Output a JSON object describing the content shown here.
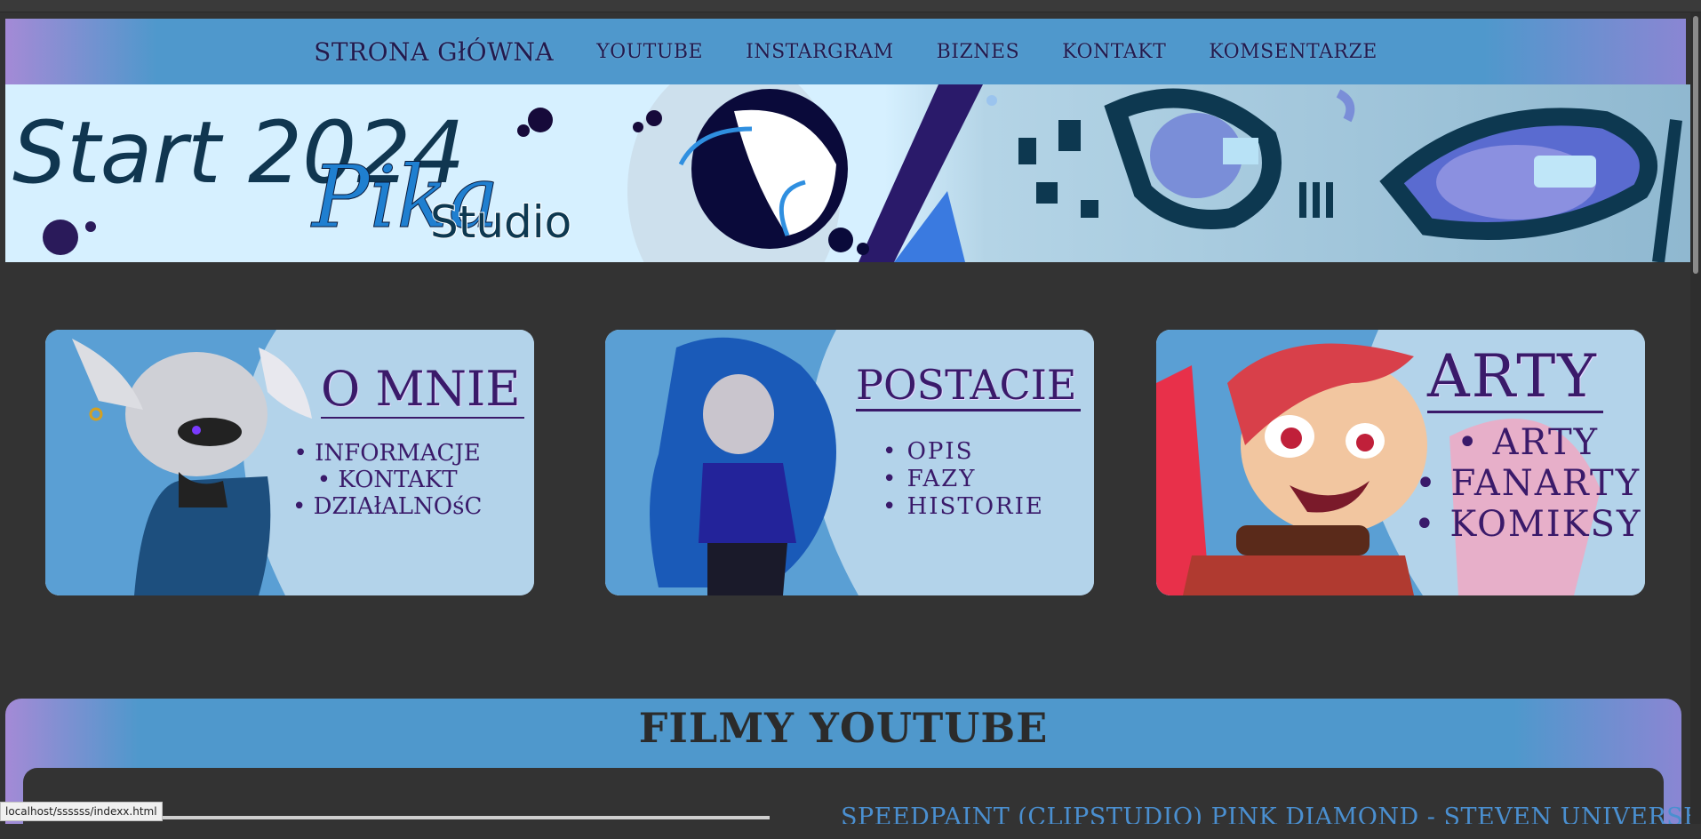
{
  "nav": {
    "items": [
      {
        "label": "STRONA GłÓWNA"
      },
      {
        "label": "YOUTUBE"
      },
      {
        "label": "INSTARGRAM"
      },
      {
        "label": "BIZNES"
      },
      {
        "label": "KONTAKT"
      },
      {
        "label": "KOMSENTARZE"
      }
    ]
  },
  "banner": {
    "line1": "Start 2024",
    "brand": "Pika",
    "studio": "Studio"
  },
  "cards": [
    {
      "title": "O MNIE",
      "items": [
        "INFORMACJE",
        "KONTAKT",
        "DZIAłALNOśC"
      ]
    },
    {
      "title": "POSTACIE",
      "items": [
        "OPIS",
        "FAZY",
        "HISTORIE"
      ]
    },
    {
      "title": "ARTY",
      "items": [
        "ARTY",
        "FANARTY",
        "KOMIKSY"
      ]
    }
  ],
  "youtube": {
    "heading": "FILMY YOUTUBE",
    "video_title": "SPEEDPAINT (CLIPSTUDIO) PINK DIAMOND - STEVEN UNIVERSE"
  },
  "status": {
    "url": "localhost/ssssss/indexx.html"
  },
  "colors": {
    "page_bg": "#333333",
    "nav_blue": "#4f98cc",
    "accent_purple": "#3a1a6a"
  }
}
